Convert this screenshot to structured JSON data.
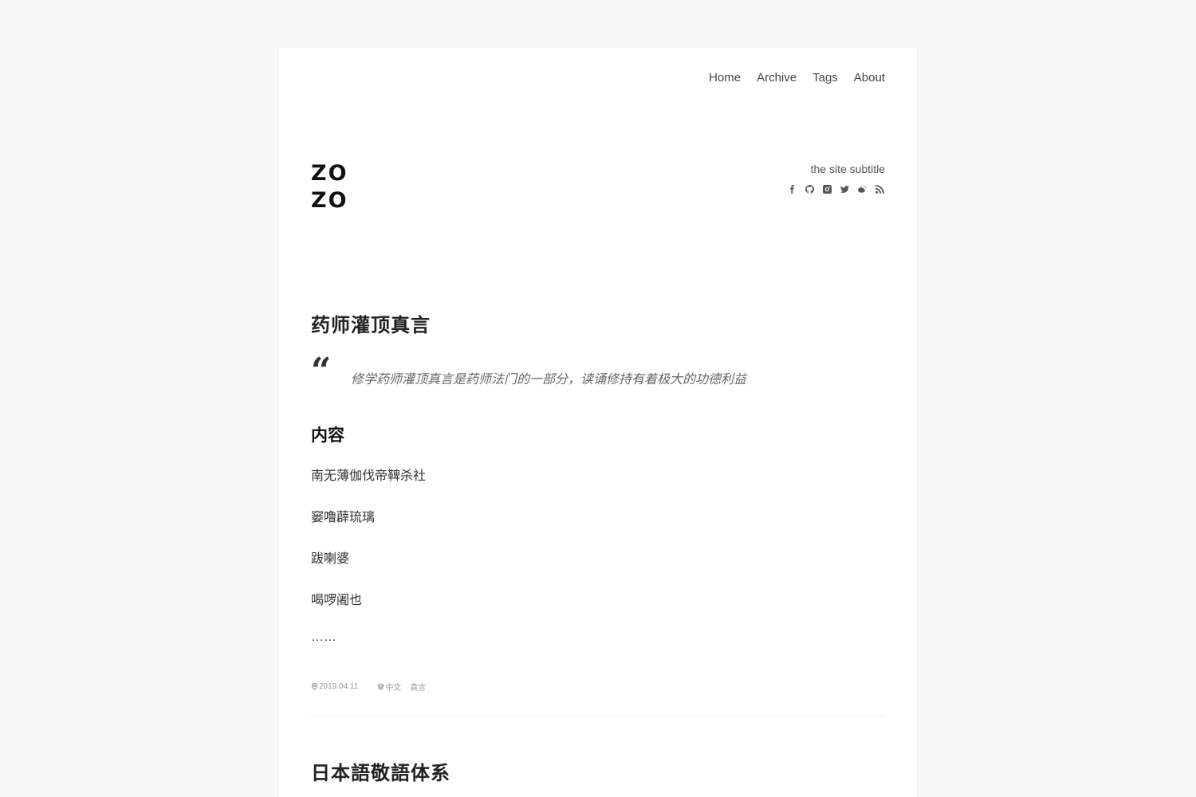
{
  "nav": {
    "items": [
      {
        "label": "Home"
      },
      {
        "label": "Archive"
      },
      {
        "label": "Tags"
      },
      {
        "label": "About"
      }
    ]
  },
  "site": {
    "logo_line1": "ZO",
    "logo_line2": "ZO",
    "subtitle": "the site subtitle",
    "socials": [
      "facebook-icon",
      "github-icon",
      "instagram-icon",
      "twitter-icon",
      "weibo-icon",
      "rss-icon"
    ]
  },
  "post": {
    "title": "药师灌顶真言",
    "quote_mark": "“",
    "excerpt": "修学药师灌顶真言是药师法门的一部分，读诵修持有着极大的功德利益",
    "section_heading": "内容",
    "paragraphs": [
      "南无薄伽伐帝鞞杀社",
      "窭噜薜琉璃",
      "跋喇婆",
      "喝啰阇也",
      "……"
    ],
    "date": "2019.04.11",
    "tags": [
      "中文",
      "真言"
    ]
  },
  "next_post": {
    "title": "日本語敬語体系"
  }
}
